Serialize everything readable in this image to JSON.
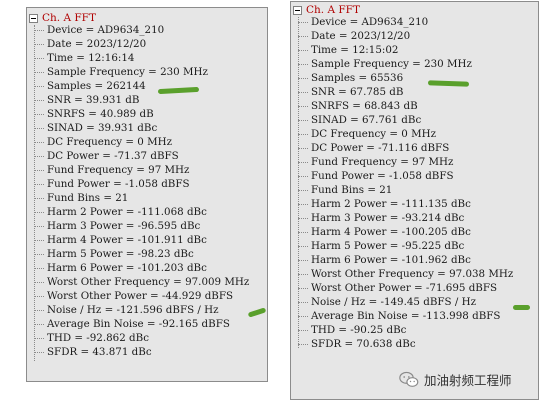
{
  "left_panel": {
    "header": "Ch. A FFT",
    "rows": [
      "Device = AD9634_210",
      "Date = 2023/12/20",
      "Time = 12:16:14",
      "Sample Frequency = 230 MHz",
      "Samples = 262144",
      "SNR = 39.931 dB",
      "SNRFS = 40.989 dB",
      "SINAD = 39.931 dBc",
      "DC Frequency = 0 MHz",
      "DC Power = -71.37 dBFS",
      "Fund Frequency = 97 MHz",
      "Fund Power = -1.058 dBFS",
      "Fund Bins = 21",
      "Harm 2 Power = -111.068 dBc",
      "Harm 3 Power = -96.595 dBc",
      "Harm 4 Power = -101.911 dBc",
      "Harm 5 Power = -98.23 dBc",
      "Harm 6 Power = -101.203 dBc",
      "Worst Other Frequency = 97.009 MHz",
      "Worst Other Power = -44.929 dBFS",
      "Noise / Hz = -121.596 dBFS / Hz",
      "Average Bin Noise = -92.165 dBFS",
      "THD = -92.862 dBc",
      "SFDR = 43.871 dBc"
    ]
  },
  "right_panel": {
    "header": "Ch. A FFT",
    "rows": [
      "Device = AD9634_210",
      "Date = 2023/12/20",
      "Time = 12:15:02",
      "Sample Frequency = 230 MHz",
      "Samples = 65536",
      "SNR = 67.785 dB",
      "SNRFS = 68.843 dB",
      "SINAD = 67.761 dBc",
      "DC Frequency = 0 MHz",
      "DC Power = -71.116 dBFS",
      "Fund Frequency = 97 MHz",
      "Fund Power = -1.058 dBFS",
      "Fund Bins = 21",
      "Harm 2 Power = -111.135 dBc",
      "Harm 3 Power = -93.214 dBc",
      "Harm 4 Power = -100.205 dBc",
      "Harm 5 Power = -95.225 dBc",
      "Harm 6 Power = -101.962 dBc",
      "Worst Other Frequency = 97.038 MHz",
      "Worst Other Power = -71.695 dBFS",
      "Noise / Hz = -149.45 dBFS / Hz",
      "Average Bin Noise = -113.998 dBFS",
      "THD = -90.25 dBc",
      "SFDR = 70.638 dBc"
    ]
  },
  "watermark": {
    "text": "加油射频工程师",
    "icon": "wechat-icon"
  },
  "colors": {
    "panel_background": "#e6e6e6",
    "header_text": "#b00000",
    "highlight_mark": "#5aa02c"
  }
}
